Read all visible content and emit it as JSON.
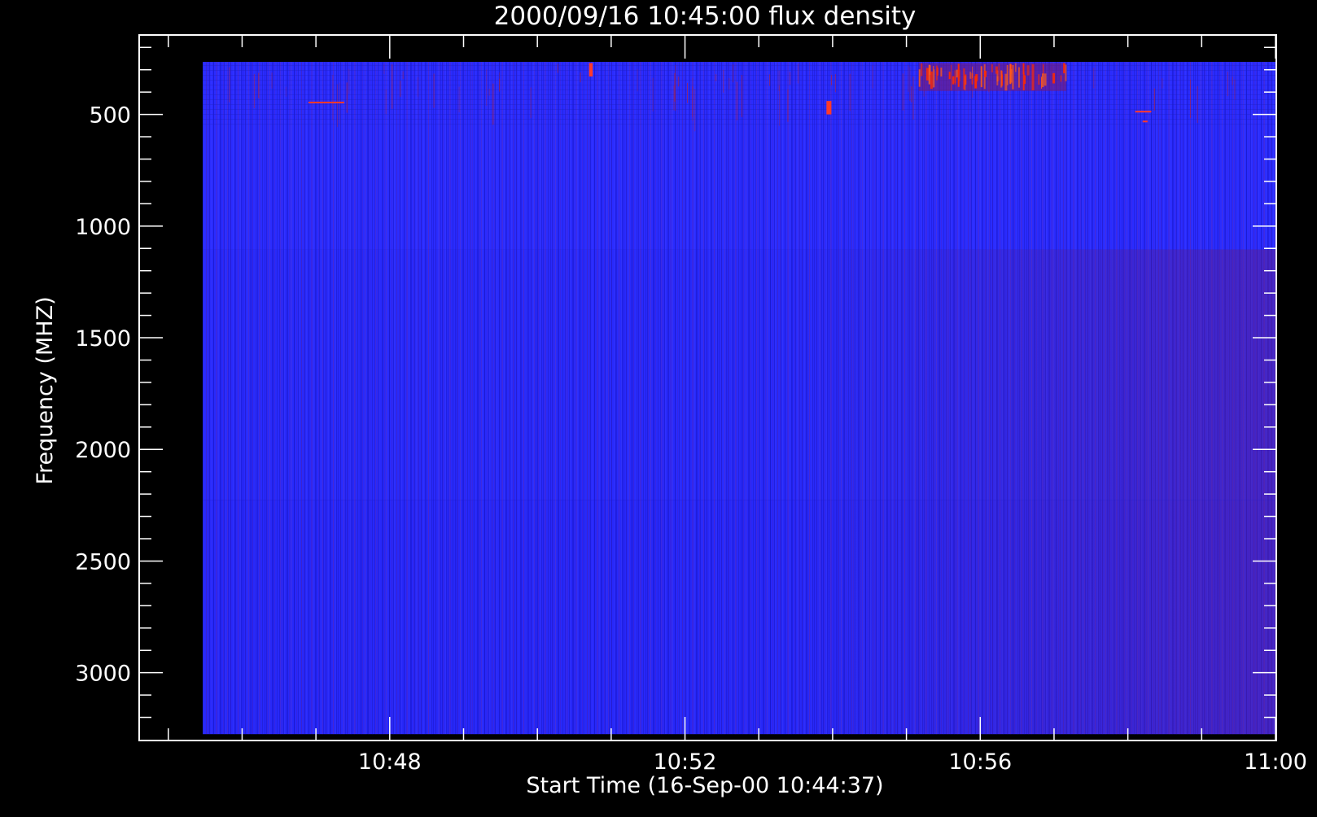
{
  "chart_data": {
    "type": "heatmap",
    "title": "2000/09/16 10:45:00 flux density",
    "xlabel": "Start Time (16-Sep-00 10:44:37)",
    "ylabel": "Frequency (MHZ)",
    "x_range": [
      "10:44:37",
      "11:00:00"
    ],
    "x_ticks": [
      "10:48",
      "10:52",
      "10:56",
      "11:00"
    ],
    "y_range": [
      148,
      3300
    ],
    "y_reversed": true,
    "y_ticks": [
      500,
      1000,
      1500,
      2000,
      2500,
      3000
    ],
    "data_extent": {
      "time_start": "10:45:28",
      "time_end": "11:00:00",
      "freq_min": 265,
      "freq_max": 3275
    },
    "frequency_bands": [
      {
        "freq_start": 265,
        "freq_end": 1105,
        "level": "low",
        "color": "#2a2cff"
      },
      {
        "freq_start": 1105,
        "freq_end": 2226,
        "level": "low",
        "color": "#2326f0"
      },
      {
        "freq_start": 2226,
        "freq_end": 3275,
        "level": "low",
        "color": "#1f1ee6"
      }
    ],
    "bursts": [
      {
        "time_start": "10:55:10",
        "time_end": "10:57:10",
        "freq_start": 270,
        "freq_end": 395,
        "level": "high"
      },
      {
        "time_start": "10:46:54",
        "time_end": "10:47:23",
        "freq_start": 443,
        "freq_end": 447,
        "level": "medium"
      },
      {
        "time_start": "10:58:06",
        "time_end": "10:58:19",
        "freq_start": 484,
        "freq_end": 488,
        "level": "medium"
      },
      {
        "time_start": "10:58:12",
        "time_end": "10:58:16",
        "freq_start": 528,
        "freq_end": 532,
        "level": "medium"
      },
      {
        "time_start": "10:50:42",
        "time_end": "10:50:45",
        "freq_start": 270,
        "freq_end": 330,
        "level": "medium"
      },
      {
        "time_start": "10:53:55",
        "time_end": "10:53:59",
        "freq_start": 440,
        "freq_end": 500,
        "level": "medium"
      }
    ],
    "colors": {
      "background": "#000000",
      "foreground": "#ffffff",
      "low": "#2a2cff",
      "high": "#ff2a00"
    },
    "grid": false,
    "legend": "none"
  }
}
